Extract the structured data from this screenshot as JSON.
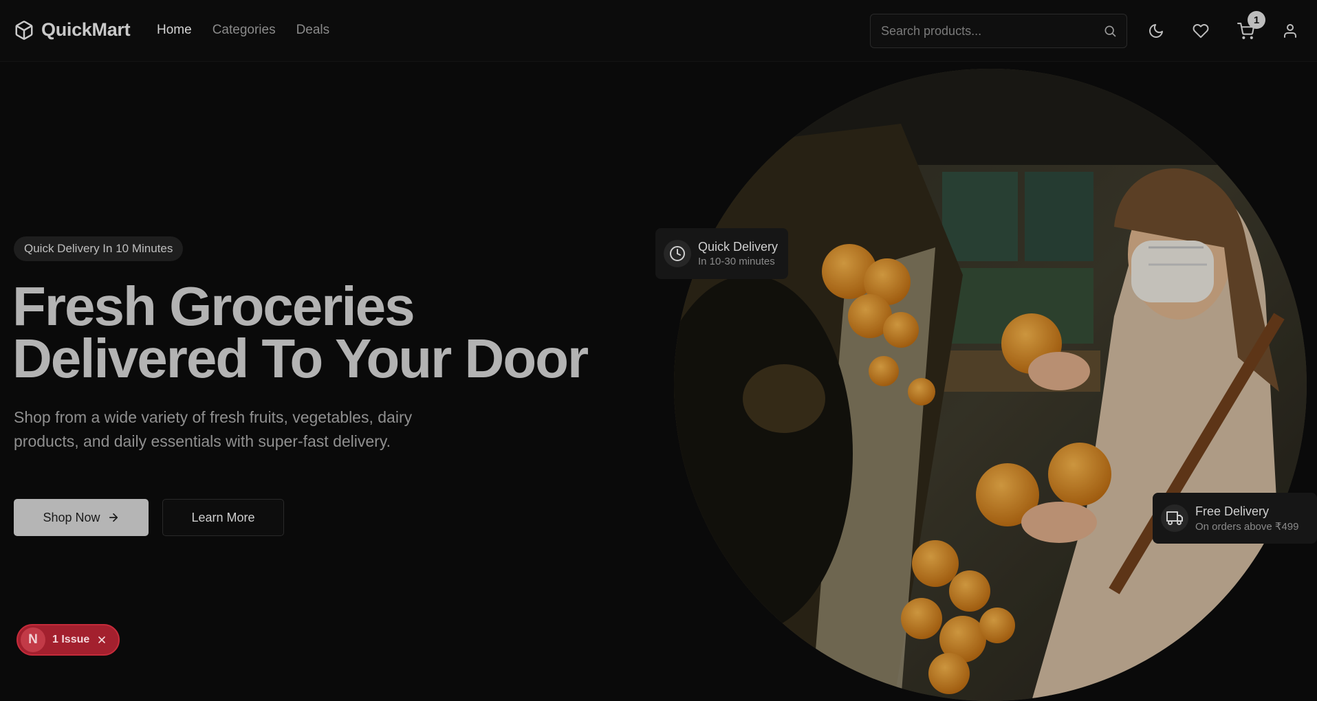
{
  "header": {
    "brand": "QuickMart",
    "nav": [
      {
        "label": "Home",
        "active": true
      },
      {
        "label": "Categories",
        "active": false
      },
      {
        "label": "Deals",
        "active": false
      }
    ],
    "search": {
      "placeholder": "Search products..."
    },
    "icons": [
      "moon-icon",
      "heart-icon",
      "cart-icon",
      "user-icon"
    ],
    "cart_count": "1"
  },
  "hero": {
    "badge": "Quick Delivery In 10 Minutes",
    "title_line1": "Fresh Groceries",
    "title_line2": "Delivered To Your Door",
    "description": "Shop from a wide variety of fresh fruits, vegetables, dairy products, and daily essentials with super-fast delivery.",
    "primary_button": "Shop Now",
    "secondary_button": "Learn More",
    "cards": {
      "quick": {
        "title": "Quick Delivery",
        "subtitle": "In 10-30 minutes"
      },
      "free": {
        "title": "Free Delivery",
        "subtitle": "On orders above ₹499"
      }
    }
  },
  "dev_overlay": {
    "letter": "N",
    "label": "1 Issue"
  },
  "colors": {
    "background": "#0a0a0a",
    "primary_button": "#b5b5b5",
    "issue_badge": "#a3202e"
  }
}
